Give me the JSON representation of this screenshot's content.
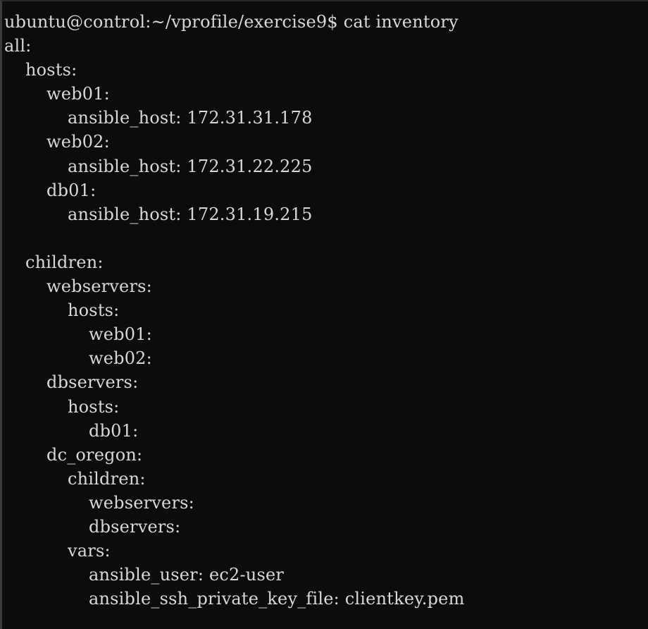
{
  "terminal": {
    "prompt": "ubuntu@control:~/vprofile/exercise9$ cat inventory",
    "lines": [
      {
        "text": "all:",
        "indent": 0
      },
      {
        "text": "hosts:",
        "indent": 1
      },
      {
        "text": "web01:",
        "indent": 2
      },
      {
        "text": "ansible_host: 172.31.31.178",
        "indent": 3
      },
      {
        "text": "web02:",
        "indent": 2
      },
      {
        "text": "ansible_host: 172.31.22.225",
        "indent": 3
      },
      {
        "text": "db01:",
        "indent": 2
      },
      {
        "text": "ansible_host: 172.31.19.215",
        "indent": 3
      },
      {
        "text": "",
        "indent": 0
      },
      {
        "text": "children:",
        "indent": 1
      },
      {
        "text": "webservers:",
        "indent": 2
      },
      {
        "text": "hosts:",
        "indent": 3
      },
      {
        "text": "web01:",
        "indent": 4
      },
      {
        "text": "web02:",
        "indent": 4
      },
      {
        "text": "dbservers:",
        "indent": 2
      },
      {
        "text": "hosts:",
        "indent": 3
      },
      {
        "text": "db01:",
        "indent": 4
      },
      {
        "text": "dc_oregon:",
        "indent": 2
      },
      {
        "text": "children:",
        "indent": 3
      },
      {
        "text": "webservers:",
        "indent": 4
      },
      {
        "text": "dbservers:",
        "indent": 4
      },
      {
        "text": "vars:",
        "indent": 3
      },
      {
        "text": "ansible_user: ec2-user",
        "indent": 4
      },
      {
        "text": "ansible_ssh_private_key_file: clientkey.pem",
        "indent": 4
      }
    ]
  }
}
